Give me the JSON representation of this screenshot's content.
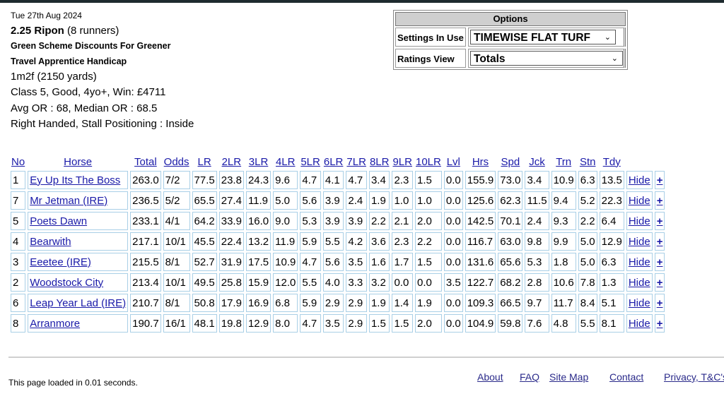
{
  "race": {
    "date": "Tue 27th Aug 2024",
    "time_course": "2.25 Ripon",
    "runners": "(8 runners)",
    "name_line1": "Green Scheme Discounts For Greener",
    "name_line2": "Travel Apprentice Handicap",
    "distance": "1m2f (2150 yards)",
    "conditions": "Class 5, Good, 4yo+, Win: £4711",
    "ratings": "Avg OR : 68, Median OR : 68.5",
    "track": "Right Handed, Stall Positioning : Inside"
  },
  "options": {
    "title": "Options",
    "settings_label": "Settings In Use",
    "settings_value": "TIMEWISE FLAT TURF",
    "view_label": "Ratings View",
    "view_value": "Totals"
  },
  "table": {
    "headers": [
      "No",
      "Horse",
      "Total",
      "Odds",
      "LR",
      "2LR",
      "3LR",
      "4LR",
      "5LR",
      "6LR",
      "7LR",
      "8LR",
      "9LR",
      "10LR",
      "Lvl",
      "Hrs",
      "Spd",
      "Jck",
      "Trn",
      "Stn",
      "Tdy"
    ],
    "hide_label": "Hide",
    "plus_label": "+",
    "rows": [
      [
        "1",
        "Ey Up Its The Boss",
        "263.0",
        "7/2",
        "77.5",
        "23.8",
        "24.3",
        "9.6",
        "4.7",
        "4.1",
        "4.7",
        "3.4",
        "2.3",
        "1.5",
        "0.0",
        "155.9",
        "73.0",
        "3.4",
        "10.9",
        "6.3",
        "13.5"
      ],
      [
        "7",
        "Mr Jetman (IRE)",
        "236.5",
        "5/2",
        "65.5",
        "27.4",
        "11.9",
        "5.0",
        "5.6",
        "3.9",
        "2.4",
        "1.9",
        "1.0",
        "1.0",
        "0.0",
        "125.6",
        "62.3",
        "11.5",
        "9.4",
        "5.2",
        "22.3"
      ],
      [
        "5",
        "Poets Dawn",
        "233.1",
        "4/1",
        "64.2",
        "33.9",
        "16.0",
        "9.0",
        "5.3",
        "3.9",
        "3.9",
        "2.2",
        "2.1",
        "2.0",
        "0.0",
        "142.5",
        "70.1",
        "2.4",
        "9.3",
        "2.2",
        "6.4"
      ],
      [
        "4",
        "Bearwith",
        "217.1",
        "10/1",
        "45.5",
        "22.4",
        "13.2",
        "11.9",
        "5.9",
        "5.5",
        "4.2",
        "3.6",
        "2.3",
        "2.2",
        "0.0",
        "116.7",
        "63.0",
        "9.8",
        "9.9",
        "5.0",
        "12.9"
      ],
      [
        "3",
        "Eeetee (IRE)",
        "215.5",
        "8/1",
        "52.7",
        "31.9",
        "17.5",
        "10.9",
        "4.7",
        "5.6",
        "3.5",
        "1.6",
        "1.7",
        "1.5",
        "0.0",
        "131.6",
        "65.6",
        "5.3",
        "1.8",
        "5.0",
        "6.3"
      ],
      [
        "2",
        "Woodstock City",
        "213.4",
        "10/1",
        "49.5",
        "25.8",
        "15.9",
        "12.0",
        "5.5",
        "4.0",
        "3.3",
        "3.2",
        "0.0",
        "0.0",
        "3.5",
        "122.7",
        "68.2",
        "2.8",
        "10.6",
        "7.8",
        "1.3"
      ],
      [
        "6",
        "Leap Year Lad (IRE)",
        "210.7",
        "8/1",
        "50.8",
        "17.9",
        "16.9",
        "6.8",
        "5.9",
        "2.9",
        "2.9",
        "1.9",
        "1.4",
        "1.9",
        "0.0",
        "109.3",
        "66.5",
        "9.7",
        "11.7",
        "8.4",
        "5.1"
      ],
      [
        "8",
        "Arranmore",
        "190.7",
        "16/1",
        "48.1",
        "19.8",
        "12.9",
        "8.0",
        "4.7",
        "3.5",
        "2.9",
        "1.5",
        "1.5",
        "2.0",
        "0.0",
        "104.9",
        "59.8",
        "7.6",
        "4.8",
        "5.5",
        "8.1"
      ]
    ]
  },
  "footer": {
    "loaded": "This page loaded in 0.01 seconds.",
    "links": [
      "About",
      "FAQ",
      "Site Map",
      "Contact",
      "Privacy, T&C's"
    ]
  }
}
